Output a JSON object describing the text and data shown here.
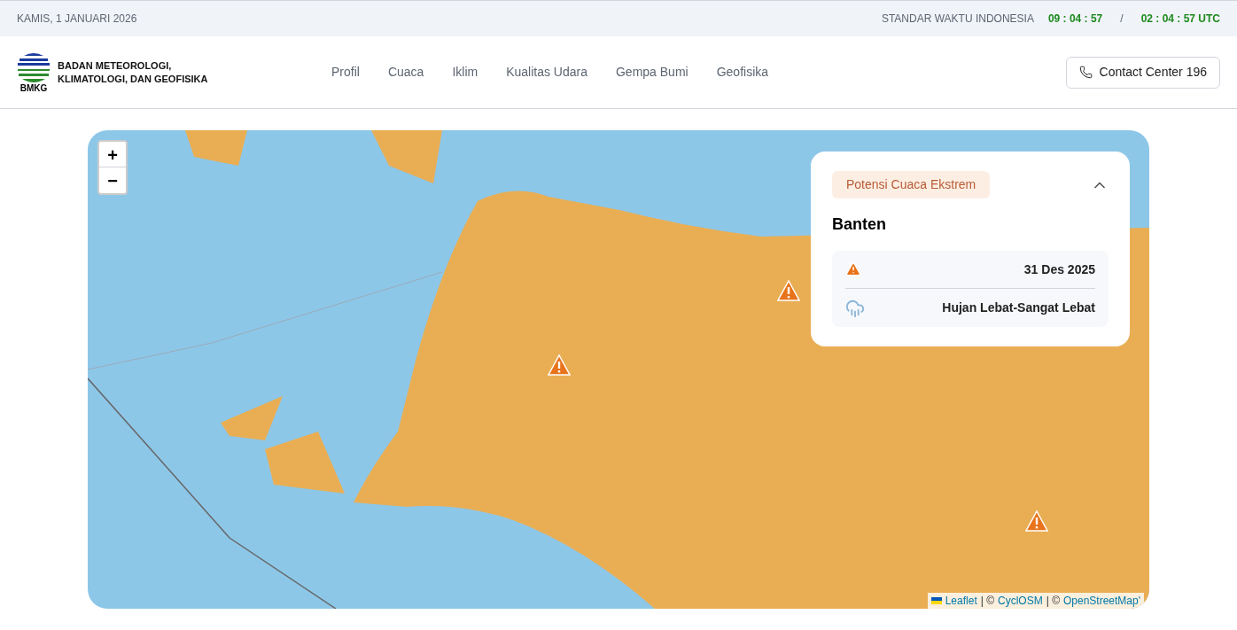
{
  "top_bar": {
    "date": "KAMIS, 1 JANUARI 2026",
    "timezone_label": "STANDAR WAKTU INDONESIA",
    "local_time": "09 : 04 : 57",
    "separator": "/",
    "utc_time": "02 : 04 : 57 UTC"
  },
  "header": {
    "logo_text": "BMKG",
    "org_name_lines": [
      "BADAN METEOROLOGI,",
      "KLIMATOLOGI, DAN GEOFISIKA"
    ],
    "nav": [
      "Profil",
      "Cuaca",
      "Iklim",
      "Kualitas Udara",
      "Gempa Bumi",
      "Geofisika"
    ],
    "contact_button": "Contact Center 196"
  },
  "map": {
    "zoom_in": "+",
    "zoom_out": "−",
    "popup": {
      "badge": "Potensi Cuaca Ekstrem",
      "expanded": true,
      "region": "Banten",
      "rows": [
        {
          "kind": "warning",
          "text": "31 Des 2025"
        },
        {
          "kind": "rain",
          "text": "Hujan Lebat-Sangat Lebat"
        }
      ]
    },
    "attribution": {
      "links": [
        "Leaflet",
        "CyclOSM",
        "OpenStreetMap'"
      ],
      "separator": "| ©"
    }
  }
}
